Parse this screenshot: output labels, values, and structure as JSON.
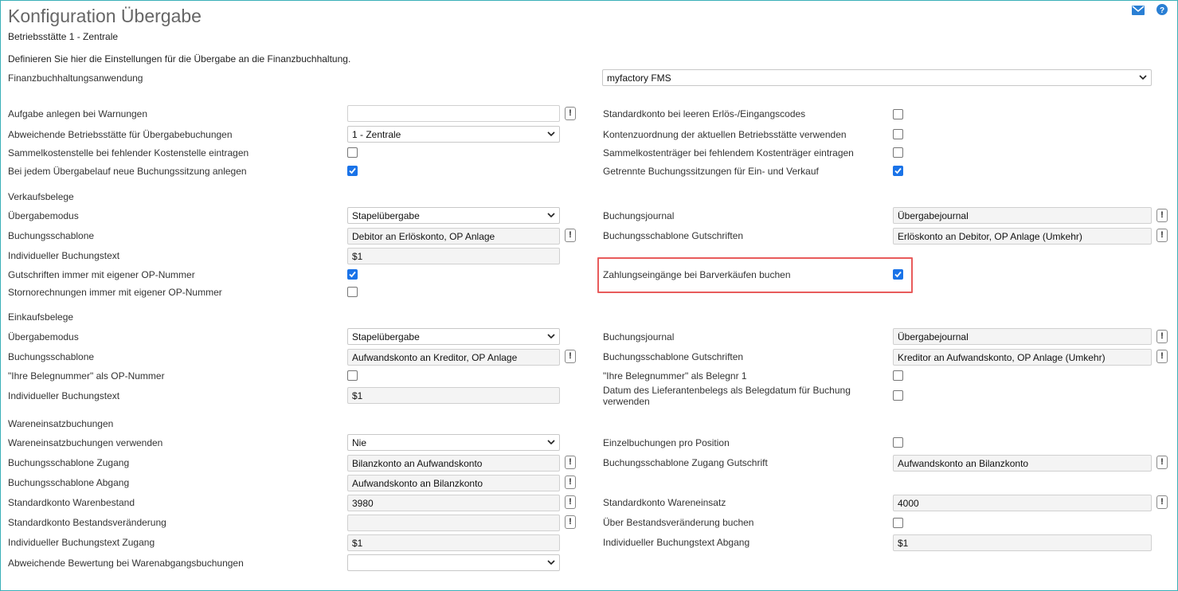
{
  "header": {
    "title": "Konfiguration Übergabe",
    "subtitle": "Betriebsstätte 1 - Zentrale",
    "description": "Definieren Sie hier die Einstellungen für die Übergabe an die Finanzbuchhaltung.",
    "icons": [
      "mail-icon",
      "help-icon"
    ]
  },
  "app": {
    "label": "Finanzbuchhaltungsanwendung",
    "value": "myfactory FMS"
  },
  "general": {
    "aufgabe_label": "Aufgabe anlegen bei Warnungen",
    "aufgabe_value": "",
    "betriebsstaette_label": "Abweichende Betriebsstätte für Übergabebuchungen",
    "betriebsstaette_value": "1 - Zentrale",
    "sammelkostenstelle_label": "Sammelkostenstelle bei fehlender Kostenstelle eintragen",
    "sammelkostenstelle_checked": false,
    "neue_sitzung_label": "Bei jedem Übergabelauf neue Buchungssitzung anlegen",
    "neue_sitzung_checked": true,
    "standardkonto_label": "Standardkonto bei leeren Erlös-/Eingangscodes",
    "standardkonto_checked": false,
    "kontenzuordnung_label": "Kontenzuordnung der aktuellen Betriebsstätte verwenden",
    "kontenzuordnung_checked": false,
    "sammelkostentraeger_label": "Sammelkostenträger bei fehlendem Kostenträger eintragen",
    "sammelkostentraeger_checked": false,
    "getrennte_label": "Getrennte Buchungssitzungen für Ein- und Verkauf",
    "getrennte_checked": true
  },
  "verkauf": {
    "section": "Verkaufsbelege",
    "modus_label": "Übergabemodus",
    "modus_value": "Stapelübergabe",
    "schablone_label": "Buchungsschablone",
    "schablone_value": "Debitor an Erlöskonto, OP Anlage",
    "text_label": "Individueller Buchungstext",
    "text_value": "$1",
    "gutschriften_op_label": "Gutschriften immer mit eigener OP-Nummer",
    "gutschriften_op_checked": true,
    "storno_label": "Stornorechnungen immer mit eigener OP-Nummer",
    "storno_checked": false,
    "journal_label": "Buchungsjournal",
    "journal_value": "Übergabejournal",
    "schablone_gs_label": "Buchungsschablone Gutschriften",
    "schablone_gs_value": "Erlöskonto an Debitor, OP Anlage (Umkehr)",
    "zahlung_label": "Zahlungseingänge bei Barverkäufen buchen",
    "zahlung_checked": true
  },
  "einkauf": {
    "section": "Einkaufsbelege",
    "modus_label": "Übergabemodus",
    "modus_value": "Stapelübergabe",
    "schablone_label": "Buchungsschablone",
    "schablone_value": "Aufwandskonto an Kreditor, OP Anlage",
    "belegnr_label": "\"Ihre Belegnummer\" als OP-Nummer",
    "belegnr_checked": false,
    "text_label": "Individueller Buchungstext",
    "text_value": "$1",
    "journal_label": "Buchungsjournal",
    "journal_value": "Übergabejournal",
    "schablone_gs_label": "Buchungsschablone Gutschriften",
    "schablone_gs_value": "Kreditor an Aufwandskonto, OP Anlage (Umkehr)",
    "belegnr1_label": "\"Ihre Belegnummer\" als Belegnr 1",
    "belegnr1_checked": false,
    "datum_label": "Datum des Lieferantenbelegs als Belegdatum für Buchung verwenden",
    "datum_checked": false
  },
  "wareneinsatz": {
    "section": "Wareneinsatzbuchungen",
    "verwenden_label": "Wareneinsatzbuchungen verwenden",
    "verwenden_value": "Nie",
    "zugang_label": "Buchungsschablone Zugang",
    "zugang_value": "Bilanzkonto an Aufwandskonto",
    "abgang_label": "Buchungsschablone Abgang",
    "abgang_value": "Aufwandskonto an Bilanzkonto",
    "bestand_label": "Standardkonto Warenbestand",
    "bestand_value": "3980",
    "bestandsveraenderung_label": "Standardkonto Bestandsveränderung",
    "bestandsveraenderung_value": "",
    "text_zugang_label": "Individueller Buchungstext Zugang",
    "text_zugang_value": "$1",
    "bewertung_label": "Abweichende Bewertung bei Warenabgangsbuchungen",
    "bewertung_value": "",
    "einzel_label": "Einzelbuchungen pro Position",
    "einzel_checked": false,
    "zugang_gs_label": "Buchungsschablone Zugang Gutschrift",
    "zugang_gs_value": "Aufwandskonto an Bilanzkonto",
    "wareneinsatz_konto_label": "Standardkonto Wareneinsatz",
    "wareneinsatz_konto_value": "4000",
    "ueber_bestand_label": "Über Bestandsveränderung buchen",
    "ueber_bestand_checked": false,
    "text_abgang_label": "Individueller Buchungstext Abgang",
    "text_abgang_value": "$1"
  },
  "colors": {
    "accent": "#1a73e8",
    "highlight": "#e85b5b",
    "frame": "#39b0b8"
  }
}
